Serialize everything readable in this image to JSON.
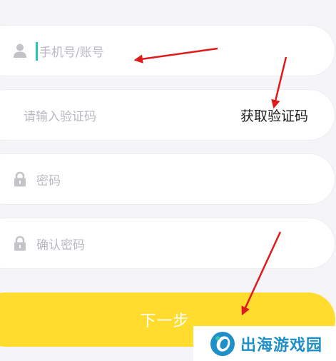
{
  "form": {
    "account_placeholder": "手机号/账号",
    "code_placeholder": "请输入验证码",
    "get_code_label": "获取验证码",
    "password_placeholder": "密码",
    "confirm_password_placeholder": "确认密码"
  },
  "next_button": {
    "label": "下一步"
  },
  "watermark": {
    "text": "出海游戏园"
  },
  "colors": {
    "background": "#f5f5f7",
    "field": "#ffffff",
    "button": "#ffdc2e",
    "caret": "#21c6b8",
    "arrow": "#e01a1a",
    "watermark": "#1e8fc7"
  },
  "icons": {
    "account": "user-icon",
    "password": "lock-icon",
    "confirm": "lock-icon"
  }
}
